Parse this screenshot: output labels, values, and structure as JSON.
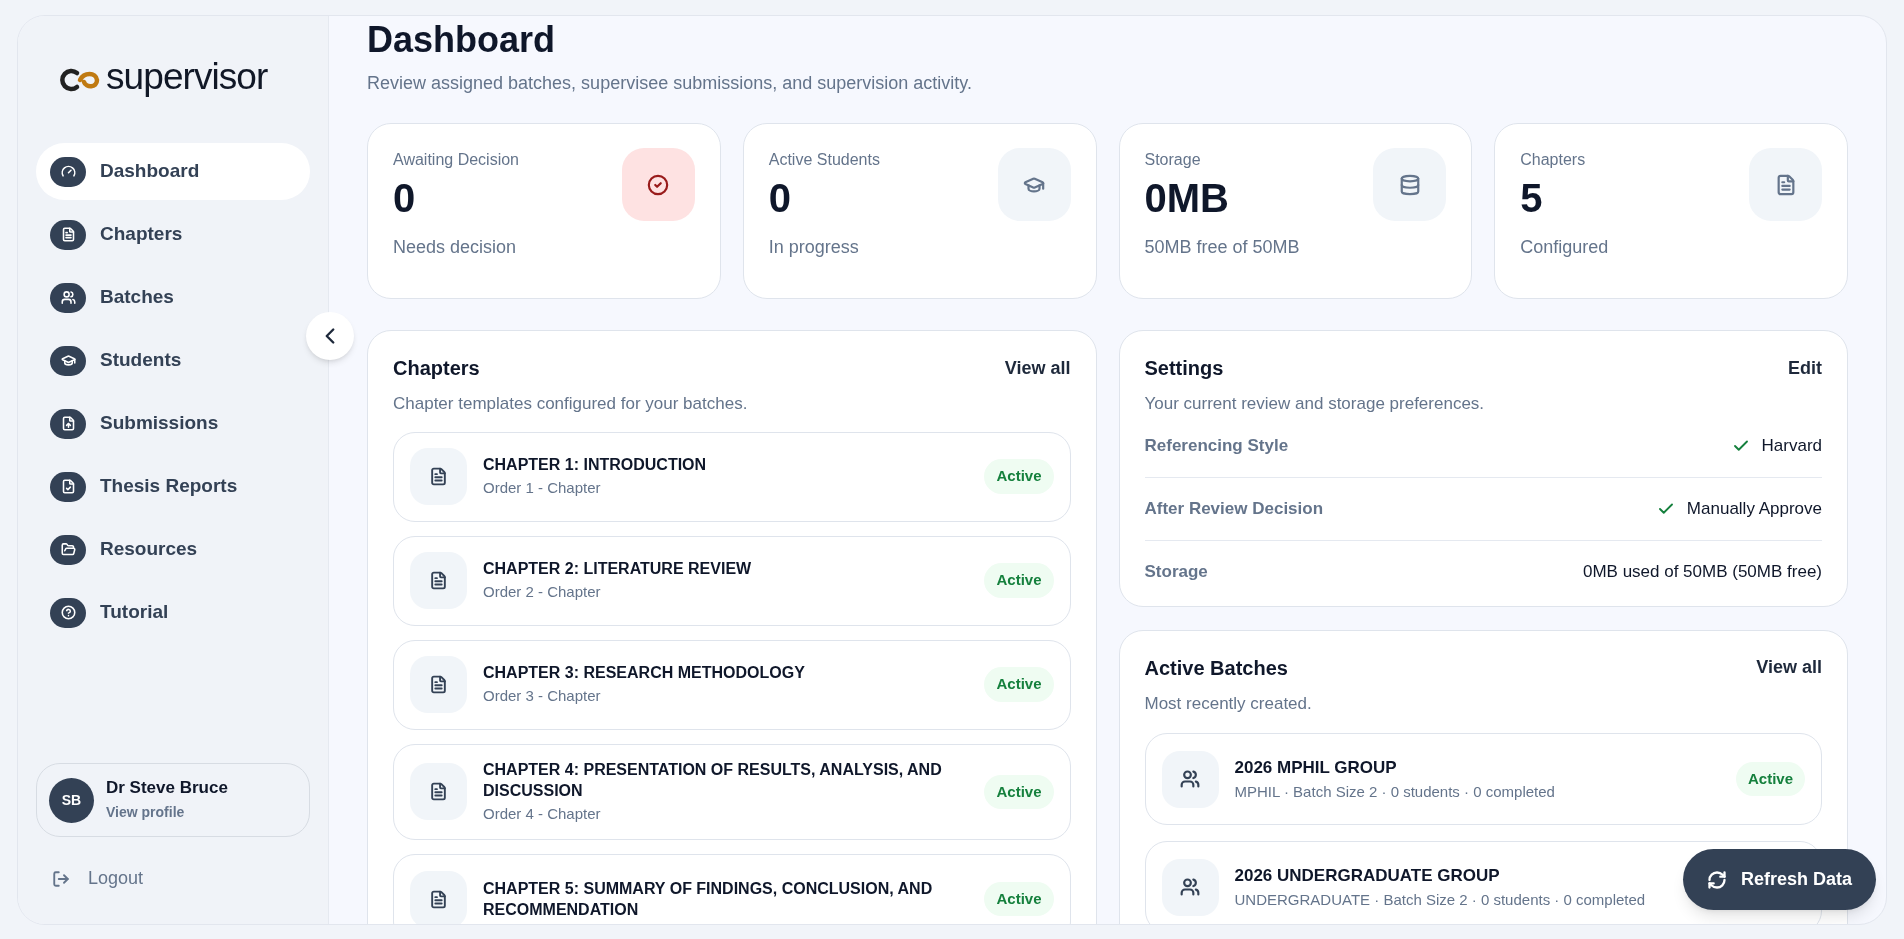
{
  "brand": {
    "name": "supervisor"
  },
  "nav": [
    {
      "label": "Dashboard",
      "kind": "gauge",
      "selected": true
    },
    {
      "label": "Chapters",
      "kind": "document",
      "selected": false
    },
    {
      "label": "Batches",
      "kind": "group",
      "selected": false
    },
    {
      "label": "Students",
      "kind": "student",
      "selected": false
    },
    {
      "label": "Submissions",
      "kind": "upload",
      "selected": false
    },
    {
      "label": "Thesis Reports",
      "kind": "report",
      "selected": false
    },
    {
      "label": "Resources",
      "kind": "folder",
      "selected": false
    },
    {
      "label": "Tutorial",
      "kind": "help",
      "selected": false
    }
  ],
  "profile": {
    "initials": "SB",
    "name": "Dr Steve Bruce",
    "link": "View profile"
  },
  "logout": {
    "label": "Logout"
  },
  "header": {
    "title": "Dashboard",
    "subtitle": "Review assigned batches, supervisee submissions, and supervision activity."
  },
  "stats": [
    {
      "label": "Awaiting Decision",
      "value": "0",
      "caption": "Needs decision",
      "kind": "decision"
    },
    {
      "label": "Active Students",
      "value": "0",
      "caption": "In progress",
      "kind": "students"
    },
    {
      "label": "Storage",
      "value": "0MB",
      "caption": "50MB free of 50MB",
      "kind": "storage"
    },
    {
      "label": "Chapters",
      "value": "5",
      "caption": "Configured",
      "kind": "chapters"
    }
  ],
  "chapters_panel": {
    "title": "Chapters",
    "action": "View all",
    "description": "Chapter templates configured for your batches.",
    "items": [
      {
        "title": "CHAPTER 1: INTRODUCTION",
        "subtitle": "Order 1 - Chapter",
        "status": "Active"
      },
      {
        "title": "CHAPTER 2: LITERATURE REVIEW",
        "subtitle": "Order 2 - Chapter",
        "status": "Active"
      },
      {
        "title": "CHAPTER 3: RESEARCH METHODOLOGY",
        "subtitle": "Order 3 - Chapter",
        "status": "Active"
      },
      {
        "title": "CHAPTER 4: PRESENTATION OF RESULTS, ANALYSIS, AND DISCUSSION",
        "subtitle": "Order 4 - Chapter",
        "status": "Active"
      },
      {
        "title": "CHAPTER 5: SUMMARY OF FINDINGS, CONCLUSION, AND RECOMMENDATION",
        "status": "Active"
      }
    ]
  },
  "settings_panel": {
    "title": "Settings",
    "action": "Edit",
    "description": "Your current review and storage preferences.",
    "rows": [
      {
        "label": "Referencing Style",
        "value": "Harvard",
        "checked": true
      },
      {
        "label": "After Review Decision",
        "value": "Manually Approve",
        "checked": true
      },
      {
        "label": "Storage",
        "value": "0MB used of 50MB (50MB free)",
        "checked": false
      }
    ]
  },
  "batches_panel": {
    "title": "Active Batches",
    "action": "View all",
    "description": "Most recently created.",
    "items": [
      {
        "name": "2026 MPHIL GROUP",
        "meta": "MPHIL · Batch Size 2 · 0 students · 0 completed",
        "status": "Active"
      },
      {
        "name": "2026 UNDERGRADUATE GROUP",
        "meta": "UNDERGRADUATE · Batch Size 2 · 0 students · 0 completed"
      }
    ]
  },
  "refresh_button": {
    "label": "Refresh Data"
  }
}
